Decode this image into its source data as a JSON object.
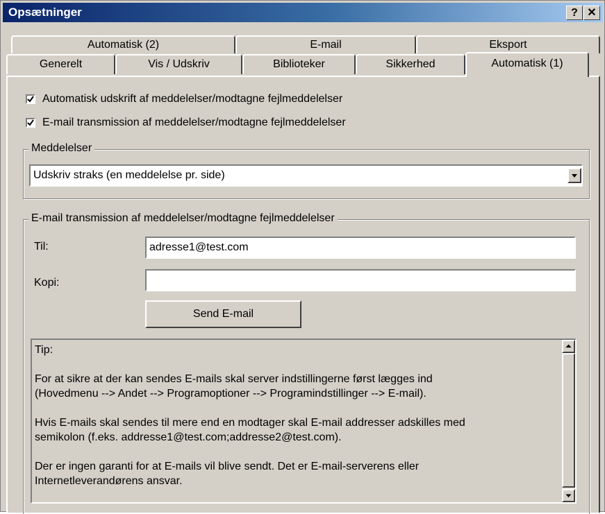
{
  "window": {
    "title": "Opsætninger",
    "help_label": "?",
    "close_label": "✕"
  },
  "tabs": {
    "row1": [
      "Automatisk (2)",
      "E-mail",
      "Eksport"
    ],
    "row2": [
      "Generelt",
      "Vis / Udskriv",
      "Biblioteker",
      "Sikkerhed",
      "Automatisk (1)"
    ],
    "active": "Automatisk (1)"
  },
  "options": {
    "auto_print": {
      "label": "Automatisk udskrift af meddelelser/modtagne fejlmeddelelser",
      "checked": true
    },
    "email_transmission": {
      "label": "E-mail transmission af meddelelser/modtagne fejlmeddelelser",
      "checked": true
    }
  },
  "messages_group": {
    "legend": "Meddelelser",
    "selected": "Udskriv straks (en meddelelse pr. side)"
  },
  "email_group": {
    "legend": "E-mail transmission af meddelelser/modtagne fejlmeddelelser",
    "to_label": "Til:",
    "to_value": "adresse1@test.com",
    "cc_label": "Kopi:",
    "cc_value": "",
    "send_label": "Send E-mail"
  },
  "tip": {
    "lines": [
      "Tip:",
      "",
      "For at sikre at der kan sendes E-mails skal server indstillingerne først lægges ind",
      "(Hovedmenu --> Andet --> Programoptioner --> Programindstillinger --> E-mail).",
      "",
      "Hvis E-mails skal sendes til mere end en modtager skal E-mail addresser adskilles med",
      "semikolon (f.eks. addresse1@test.com;addresse2@test.com).",
      "",
      "Der er ingen garanti for at E-mails vil blive sendt. Det er E-mail-serverens eller",
      "Internetleverandørens ansvar."
    ]
  },
  "icons": {
    "check": "checkmark-icon",
    "dropdown": "triangle-down-icon",
    "scroll_up": "triangle-up-icon",
    "scroll_down": "triangle-down-icon"
  }
}
